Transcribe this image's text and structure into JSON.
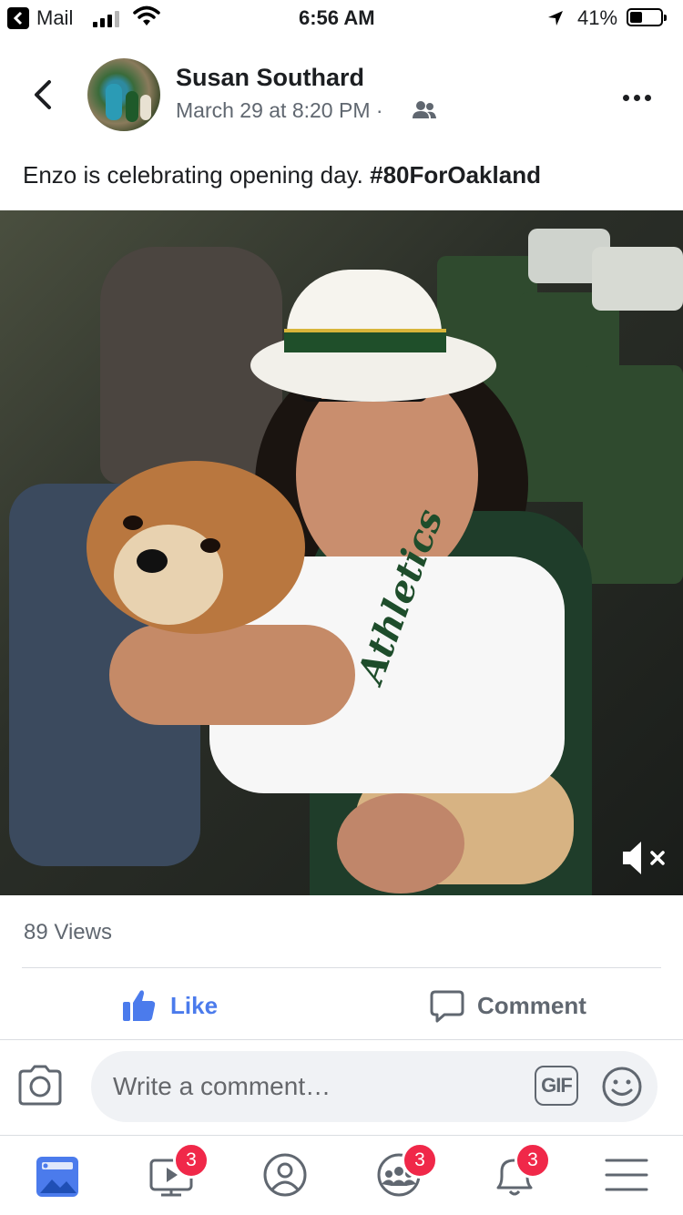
{
  "status_bar": {
    "back_app": "Mail",
    "time": "6:56 AM",
    "battery": "41%",
    "battery_level": 0.41
  },
  "post": {
    "author": "Susan Southard",
    "date": "March 29 at 8:20 PM · ",
    "text": "Enzo is celebrating opening day.  ",
    "hashtag": "#80ForOakland",
    "video_overlay_text": "Athletics",
    "views": "89 Views"
  },
  "actions": {
    "like_label": "Like",
    "comment_label": "Comment"
  },
  "composer": {
    "placeholder": "Write a comment…",
    "gif_label": "GIF"
  },
  "tab_bar": {
    "tabs": [
      {
        "icon": "news-feed-icon",
        "badge": ""
      },
      {
        "icon": "watch-icon",
        "badge": "3"
      },
      {
        "icon": "profile-icon",
        "badge": ""
      },
      {
        "icon": "groups-icon",
        "badge": "3"
      },
      {
        "icon": "notifications-icon",
        "badge": "3"
      },
      {
        "icon": "menu-icon",
        "badge": ""
      }
    ]
  },
  "colors": {
    "accent": "#4b7bec",
    "badge": "#f02849",
    "secondary_text": "#606770"
  }
}
